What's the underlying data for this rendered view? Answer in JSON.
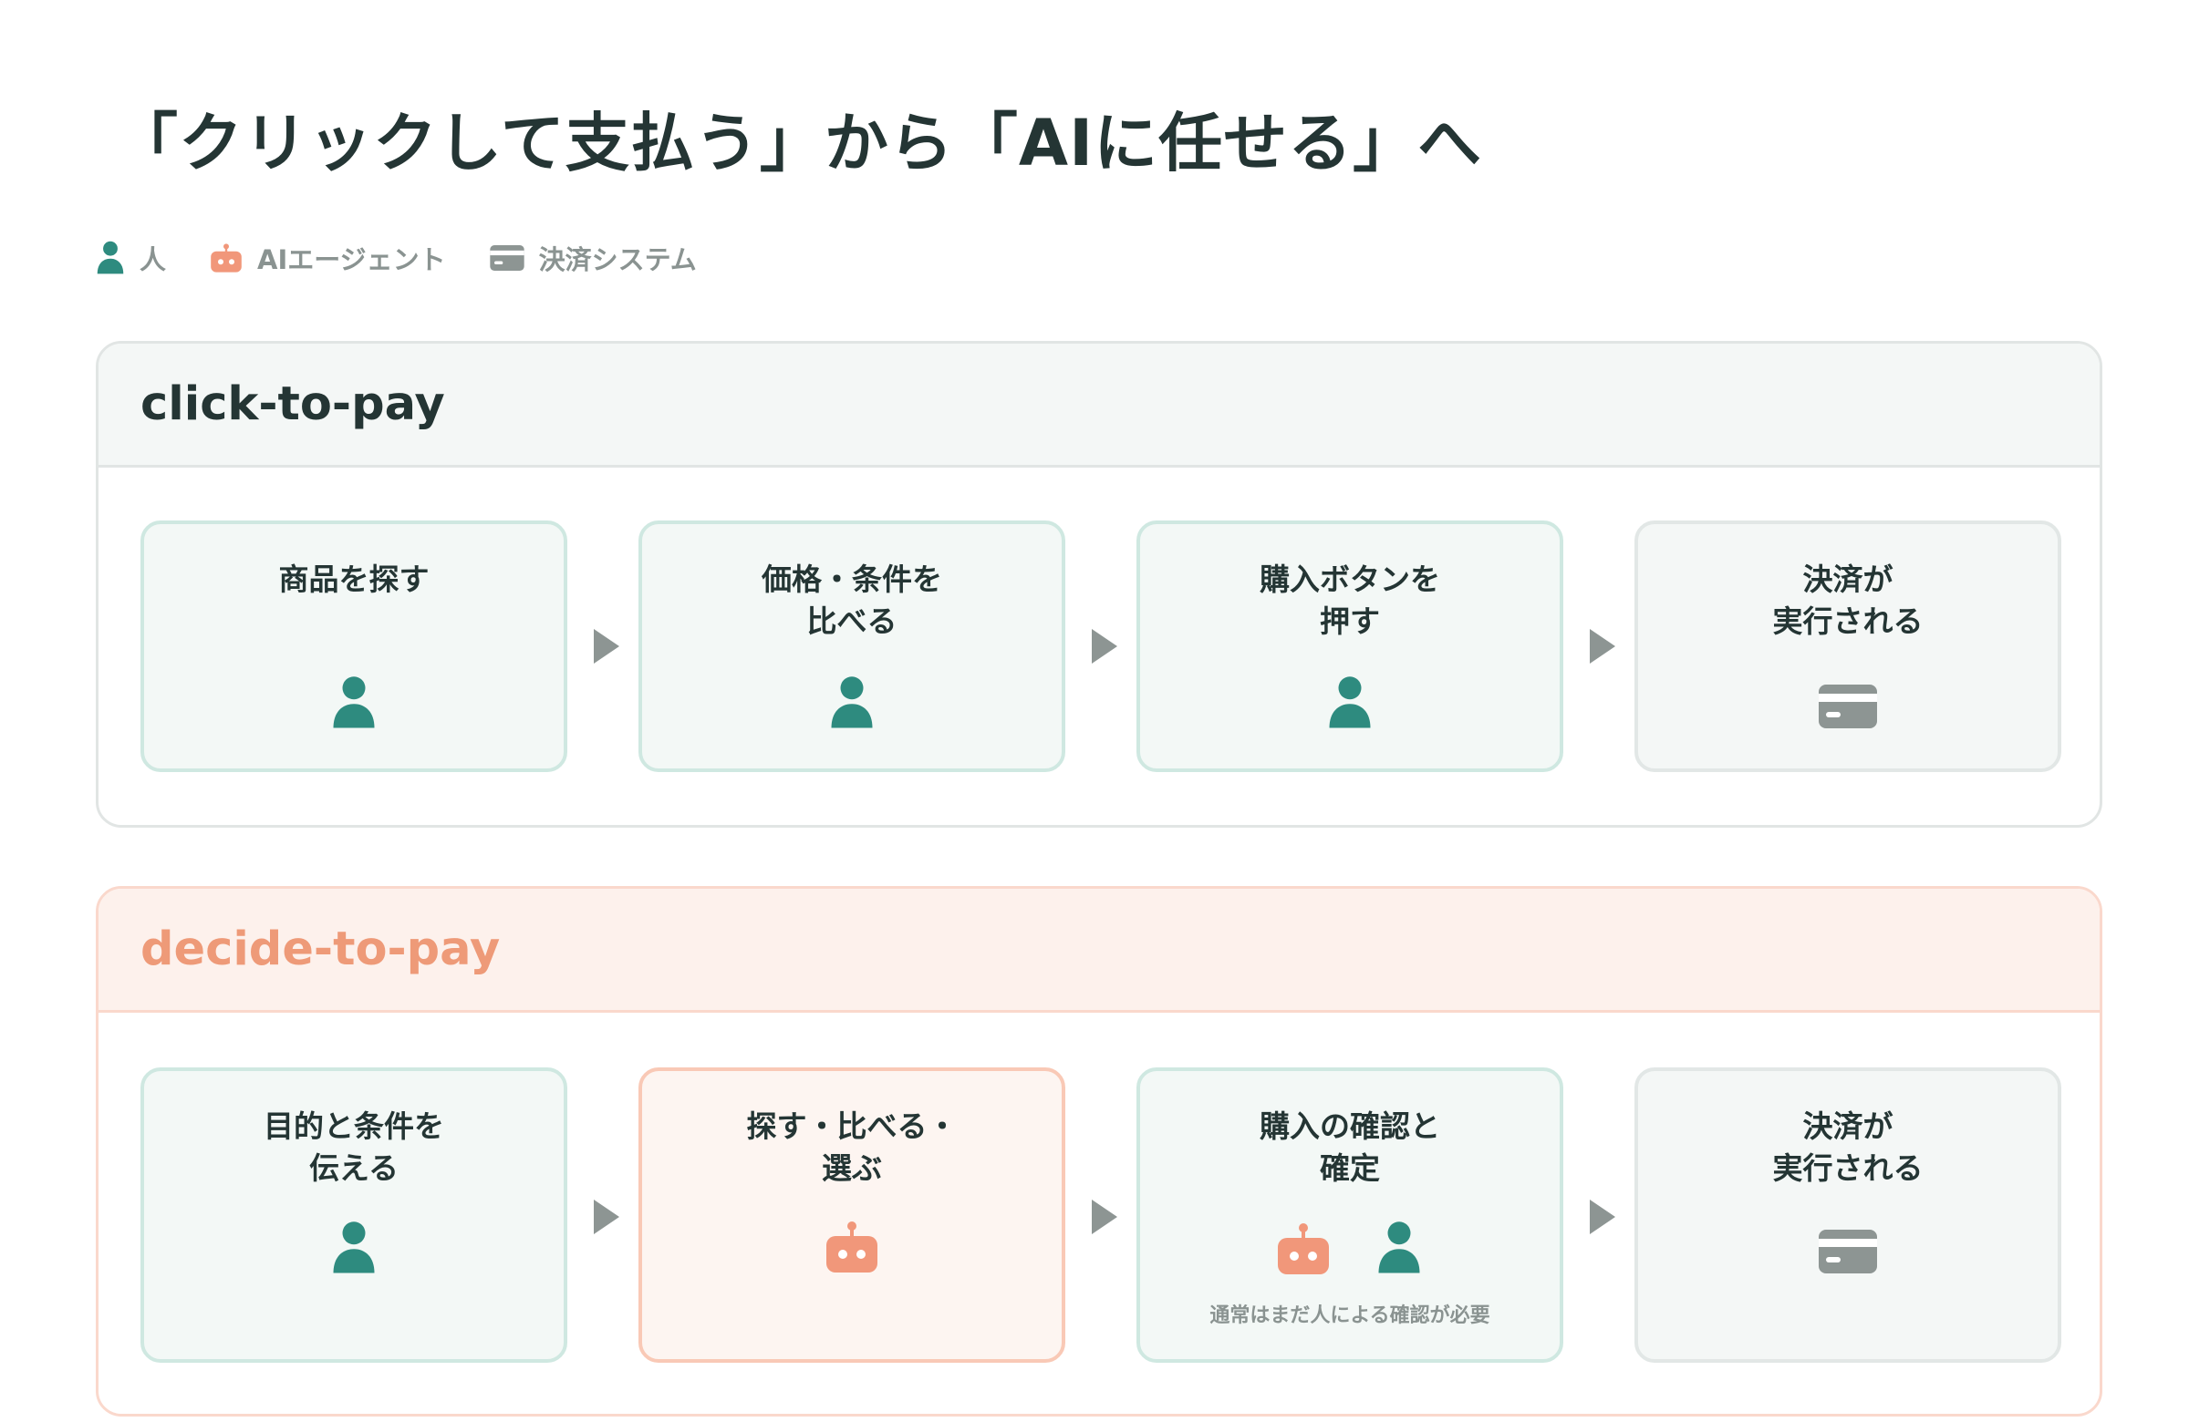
{
  "title": "「クリックして支払う」から「AIに任せる」へ",
  "legend": {
    "person": "人",
    "ai_agent": "AIエージェント",
    "payment_system": "決済システム"
  },
  "sections": [
    {
      "name": "click-to-pay",
      "steps": [
        {
          "label": "商品を探す",
          "icon": "person-icon"
        },
        {
          "label": "価格・条件を\n比べる",
          "icon": "person-icon"
        },
        {
          "label": "購入ボタンを\n押す",
          "icon": "person-icon"
        },
        {
          "label": "決済が\n実行される",
          "icon": "card-icon"
        }
      ]
    },
    {
      "name": "decide-to-pay",
      "steps": [
        {
          "label": "目的と条件を\n伝える",
          "icon": "person-icon"
        },
        {
          "label": "探す・比べる・\n選ぶ",
          "icon": "robot-icon"
        },
        {
          "label": "購入の確認と\n確定",
          "icon": "robot-icon + person-icon",
          "note": "通常はまだ人による確認が必要"
        },
        {
          "label": "決済が\n実行される",
          "icon": "card-icon"
        }
      ]
    }
  ],
  "colors": {
    "person": "#2e8b7f",
    "ai_agent": "#f1977a",
    "payment_system": "#8d9593",
    "title": "#243534",
    "decide_header": "#ee9a78"
  }
}
